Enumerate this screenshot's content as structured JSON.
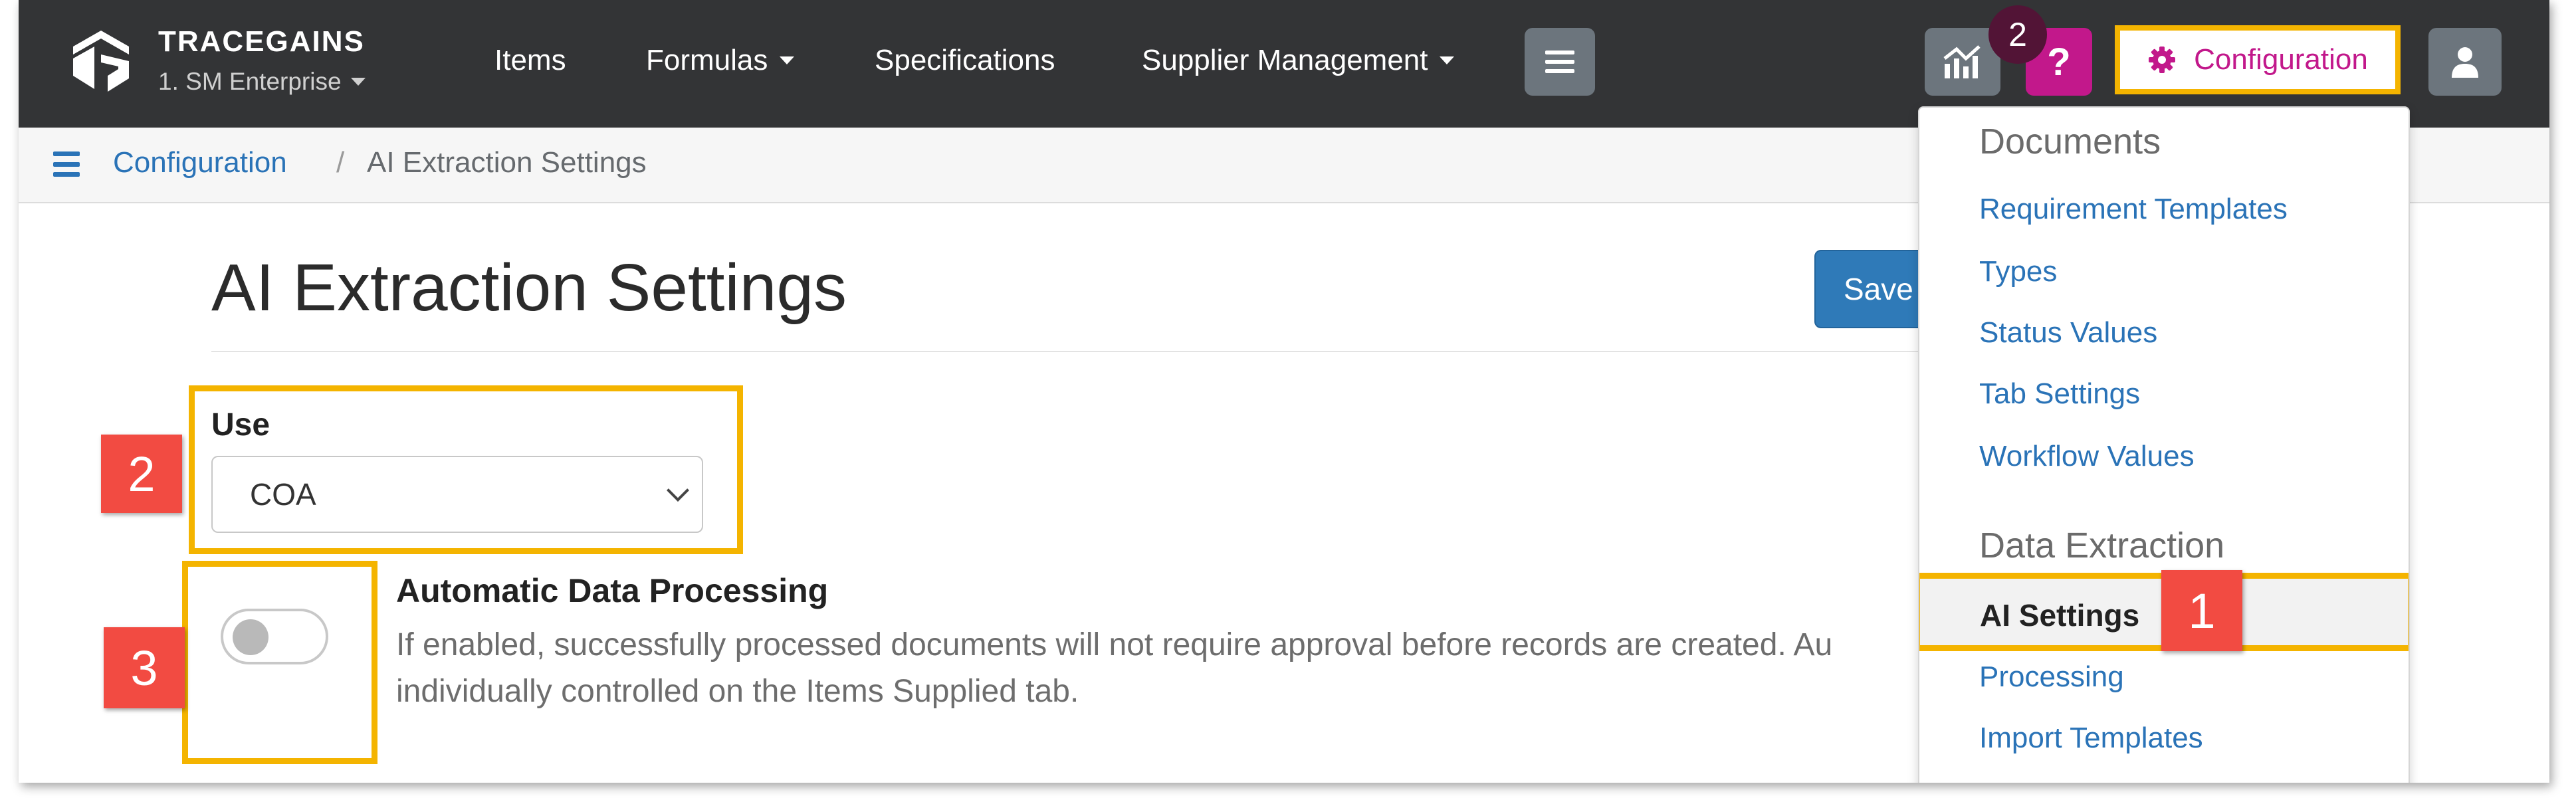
{
  "navbar": {
    "brand_name": "TRACEGAINS",
    "org_selector": "1. SM Enterprise",
    "links": {
      "items": "Items",
      "formulas": "Formulas",
      "specifications": "Specifications",
      "supplier_management": "Supplier Management"
    },
    "help_label": "?",
    "notification_count": "2",
    "configuration_label": "Configuration"
  },
  "breadcrumb": {
    "root": "Configuration",
    "separator": "/",
    "current": "AI Extraction Settings"
  },
  "page": {
    "title": "AI Extraction Settings",
    "save_label": "Save",
    "use_label": "Use",
    "use_value": "COA",
    "auto_processing_title": "Automatic Data Processing",
    "auto_processing_desc": "If enabled, successfully processed documents will not require approval before records are created. Au\nindividually controlled on the Items Supplied tab.",
    "auto_processing_enabled": false
  },
  "config_menu": {
    "documents_header": "Documents",
    "documents_items": [
      "Requirement Templates",
      "Types",
      "Status Values",
      "Tab Settings",
      "Workflow Values"
    ],
    "data_extraction_header": "Data Extraction",
    "active_item": "AI Settings",
    "data_extraction_items": [
      "Processing",
      "Import Templates"
    ]
  },
  "annotations": {
    "step_1": "1",
    "step_2": "2",
    "step_3": "3"
  },
  "colors": {
    "navbar_bg": "#333436",
    "accent_magenta": "#c2188b",
    "link_blue": "#2a73b7",
    "highlight_yellow": "#f4b400",
    "step_red": "#f24b42",
    "save_blue": "#2f7ab8"
  }
}
